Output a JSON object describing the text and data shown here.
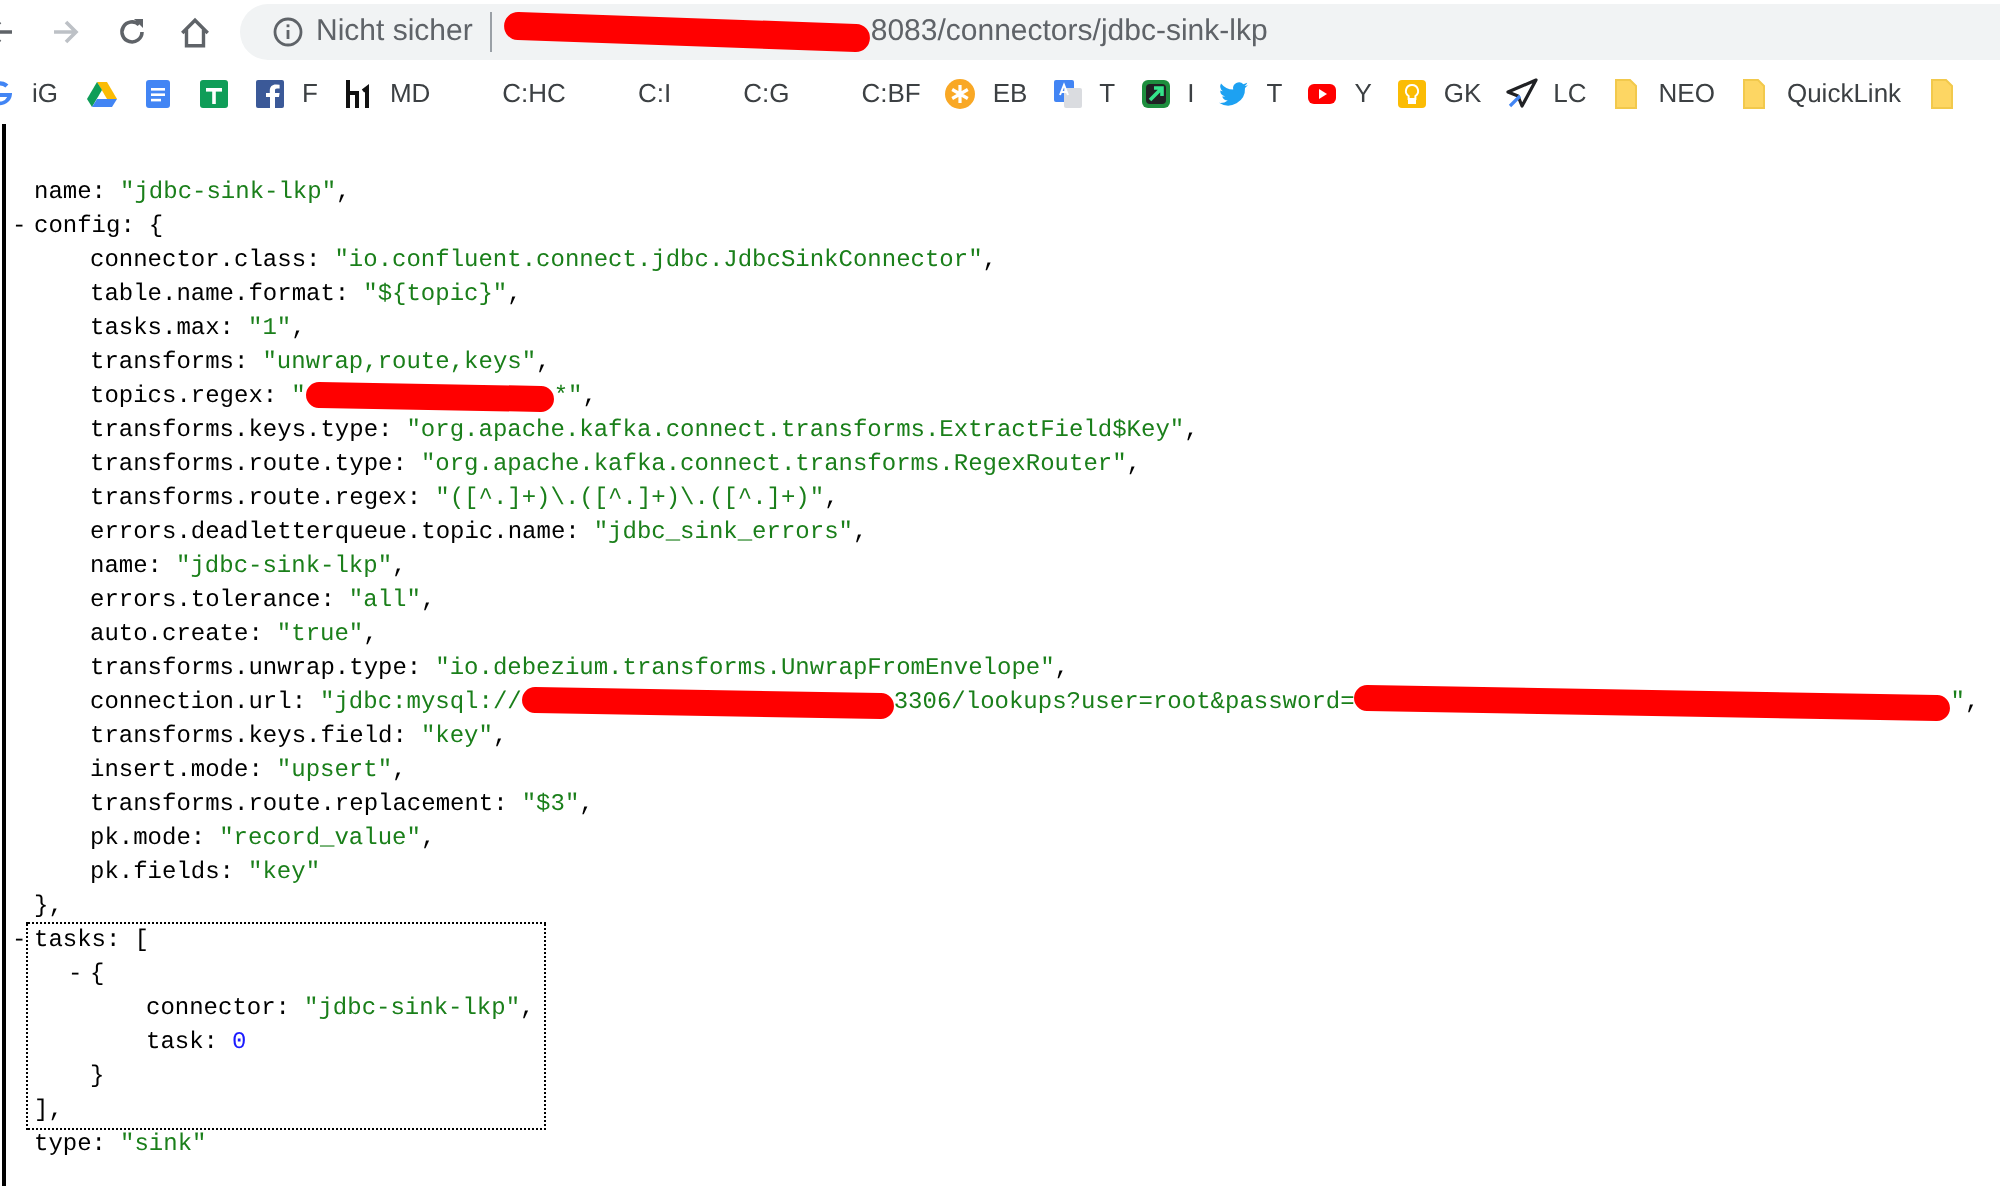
{
  "toolbar": {
    "address": {
      "security_label": "Nicht sicher",
      "url_parts": [
        {
          "kind": "redaction"
        },
        {
          "kind": "text",
          "text": "8083/connectors/jdbc-sink-lkp"
        }
      ]
    }
  },
  "bookmarks": [
    {
      "kind": "g",
      "label": "iG"
    },
    {
      "kind": "drive"
    },
    {
      "kind": "docs"
    },
    {
      "kind": "sheets"
    },
    {
      "kind": "facebook",
      "label": "F"
    },
    {
      "kind": "h1",
      "label": "MD"
    },
    {
      "kind": "blank",
      "label": "C:HC"
    },
    {
      "kind": "blank",
      "label": "C:I"
    },
    {
      "kind": "blank",
      "label": "C:G"
    },
    {
      "kind": "blank",
      "label": "C:BF"
    },
    {
      "kind": "star",
      "label": "EB"
    },
    {
      "kind": "translate",
      "label": "T"
    },
    {
      "kind": "arrowapp",
      "label": "I"
    },
    {
      "kind": "bird",
      "label": "T"
    },
    {
      "kind": "play",
      "label": "Y"
    },
    {
      "kind": "bulb",
      "label": "GK"
    },
    {
      "kind": "plane",
      "label": "LC"
    },
    {
      "kind": "folder",
      "label": "NEO"
    },
    {
      "kind": "folder",
      "label": "QuickLink"
    },
    {
      "kind": "folder"
    }
  ],
  "document": [
    {
      "key": "name:",
      "value": "\"jdbc-sink-lkp\"",
      "kind": "string",
      "after": ","
    },
    {
      "toggle": "-",
      "key": "config:",
      "open": "{",
      "close": "},",
      "children": [
        {
          "key": "connector.class:",
          "value": "\"io.confluent.connect.jdbc.JdbcSinkConnector\"",
          "kind": "string",
          "after": ","
        },
        {
          "key": "table.name.format:",
          "value": "\"${topic}\"",
          "kind": "string",
          "after": ","
        },
        {
          "key": "tasks.max:",
          "value": "\"1\"",
          "kind": "string",
          "after": ","
        },
        {
          "key": "transforms:",
          "value": "\"unwrap,route,keys\"",
          "kind": "string",
          "after": ","
        },
        {
          "key": "topics.regex:",
          "parts": [
            {
              "kind": "text",
              "text": "\""
            },
            {
              "kind": "redaction"
            },
            {
              "kind": "text",
              "text": "*\""
            }
          ],
          "kind": "string",
          "after": ","
        },
        {
          "key": "transforms.keys.type:",
          "value": "\"org.apache.kafka.connect.transforms.ExtractField$Key\"",
          "kind": "string",
          "after": ","
        },
        {
          "key": "transforms.route.type:",
          "value": "\"org.apache.kafka.connect.transforms.RegexRouter\"",
          "kind": "string",
          "after": ","
        },
        {
          "key": "transforms.route.regex:",
          "value": "\"([^.]+)\\.([^.]+)\\.([^.]+)\"",
          "kind": "string",
          "after": ","
        },
        {
          "key": "errors.deadletterqueue.topic.name:",
          "value": "\"jdbc_sink_errors\"",
          "kind": "string",
          "after": ","
        },
        {
          "key": "name:",
          "value": "\"jdbc-sink-lkp\"",
          "kind": "string",
          "after": ","
        },
        {
          "key": "errors.tolerance:",
          "value": "\"all\"",
          "kind": "string",
          "after": ","
        },
        {
          "key": "auto.create:",
          "value": "\"true\"",
          "kind": "string",
          "after": ","
        },
        {
          "key": "transforms.unwrap.type:",
          "value": "\"io.debezium.transforms.UnwrapFromEnvelope\"",
          "kind": "string",
          "after": ","
        },
        {
          "key": "connection.url:",
          "parts": [
            {
              "kind": "text",
              "text": "\"jdbc:mysql://"
            },
            {
              "kind": "redaction"
            },
            {
              "kind": "text",
              "text": "3306/lookups?user=root&password="
            },
            {
              "kind": "redaction"
            },
            {
              "kind": "text",
              "text": "\""
            }
          ],
          "kind": "string",
          "after": ","
        },
        {
          "key": "transforms.keys.field:",
          "value": "\"key\"",
          "kind": "string",
          "after": ","
        },
        {
          "key": "insert.mode:",
          "value": "\"upsert\"",
          "kind": "string",
          "after": ","
        },
        {
          "key": "transforms.route.replacement:",
          "value": "\"$3\"",
          "kind": "string",
          "after": ","
        },
        {
          "key": "pk.mode:",
          "value": "\"record_value\"",
          "kind": "string",
          "after": ","
        },
        {
          "key": "pk.fields:",
          "value": "\"key\"",
          "kind": "string"
        }
      ]
    },
    {
      "toggle": "-",
      "key": "tasks:",
      "open": "[",
      "close": "],",
      "focused": true,
      "children": [
        {
          "toggle": "-",
          "open": "{",
          "close": "}",
          "children": [
            {
              "key": "connector:",
              "value": "\"jdbc-sink-lkp\"",
              "kind": "string",
              "after": ","
            },
            {
              "key": "task:",
              "value": "0",
              "kind": "number"
            }
          ]
        }
      ]
    },
    {
      "key": "type:",
      "value": "\"sink\"",
      "kind": "string"
    }
  ]
}
